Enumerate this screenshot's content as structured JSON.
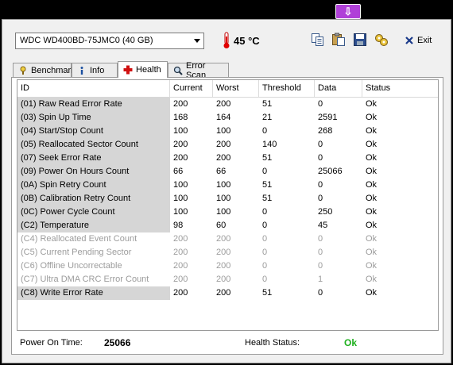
{
  "topbar": {
    "download_icon": "download-arrow-icon",
    "badge_color": "#b040d8"
  },
  "toolbar": {
    "drive": "WDC WD400BD-75JMC0 (40 GB)",
    "temperature": "45 °C",
    "exit_label": "Exit"
  },
  "tabs": [
    {
      "label": "Benchmark",
      "icon": "benchmark-icon"
    },
    {
      "label": "Info",
      "icon": "info-icon"
    },
    {
      "label": "Health",
      "icon": "health-cross-icon",
      "active": true
    },
    {
      "label": "Error Scan",
      "icon": "magnifier-icon"
    }
  ],
  "table": {
    "headers": {
      "id": "ID",
      "current": "Current",
      "worst": "Worst",
      "threshold": "Threshold",
      "data": "Data",
      "status": "Status"
    },
    "rows": [
      {
        "id": "(01) Raw Read Error Rate",
        "current": "200",
        "worst": "200",
        "threshold": "51",
        "data": "0",
        "status": "Ok",
        "dim": false
      },
      {
        "id": "(03) Spin Up Time",
        "current": "168",
        "worst": "164",
        "threshold": "21",
        "data": "2591",
        "status": "Ok",
        "dim": false
      },
      {
        "id": "(04) Start/Stop Count",
        "current": "100",
        "worst": "100",
        "threshold": "0",
        "data": "268",
        "status": "Ok",
        "dim": false
      },
      {
        "id": "(05) Reallocated Sector Count",
        "current": "200",
        "worst": "200",
        "threshold": "140",
        "data": "0",
        "status": "Ok",
        "dim": false
      },
      {
        "id": "(07) Seek Error Rate",
        "current": "200",
        "worst": "200",
        "threshold": "51",
        "data": "0",
        "status": "Ok",
        "dim": false
      },
      {
        "id": "(09) Power On Hours Count",
        "current": "66",
        "worst": "66",
        "threshold": "0",
        "data": "25066",
        "status": "Ok",
        "dim": false
      },
      {
        "id": "(0A) Spin Retry Count",
        "current": "100",
        "worst": "100",
        "threshold": "51",
        "data": "0",
        "status": "Ok",
        "dim": false
      },
      {
        "id": "(0B) Calibration Retry Count",
        "current": "100",
        "worst": "100",
        "threshold": "51",
        "data": "0",
        "status": "Ok",
        "dim": false
      },
      {
        "id": "(0C) Power Cycle Count",
        "current": "100",
        "worst": "100",
        "threshold": "0",
        "data": "250",
        "status": "Ok",
        "dim": false
      },
      {
        "id": "(C2) Temperature",
        "current": "98",
        "worst": "60",
        "threshold": "0",
        "data": "45",
        "status": "Ok",
        "dim": false
      },
      {
        "id": "(C4) Reallocated Event Count",
        "current": "200",
        "worst": "200",
        "threshold": "0",
        "data": "0",
        "status": "Ok",
        "dim": true
      },
      {
        "id": "(C5) Current Pending Sector",
        "current": "200",
        "worst": "200",
        "threshold": "0",
        "data": "0",
        "status": "Ok",
        "dim": true
      },
      {
        "id": "(C6) Offline Uncorrectable",
        "current": "200",
        "worst": "200",
        "threshold": "0",
        "data": "0",
        "status": "Ok",
        "dim": true
      },
      {
        "id": "(C7) Ultra DMA CRC Error Count",
        "current": "200",
        "worst": "200",
        "threshold": "0",
        "data": "1",
        "status": "Ok",
        "dim": true
      },
      {
        "id": "(C8) Write Error Rate",
        "current": "200",
        "worst": "200",
        "threshold": "51",
        "data": "0",
        "status": "Ok",
        "dim": false
      }
    ]
  },
  "footer": {
    "power_on_label": "Power On Time:",
    "power_on_value": "25066",
    "health_label": "Health Status:",
    "health_value": "Ok",
    "health_color": "#1db01d"
  }
}
